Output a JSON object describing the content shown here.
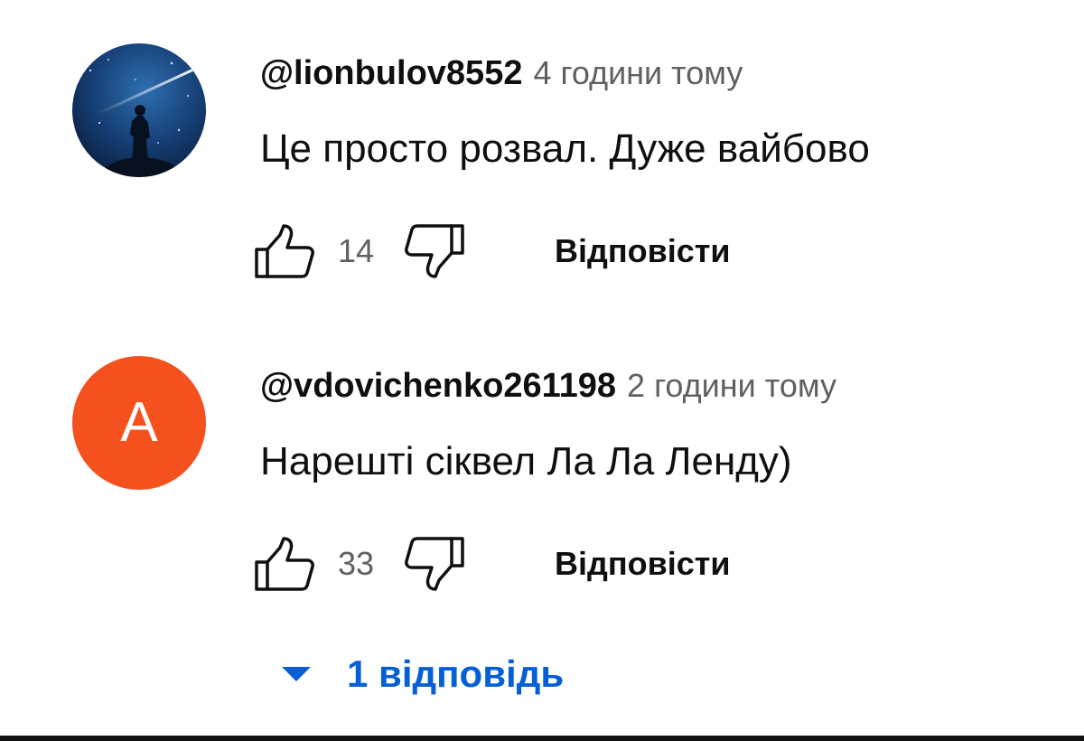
{
  "comments": [
    {
      "author": "@lionbulov8552",
      "time": "4 години тому",
      "text": "Це просто розвал. Дуже вайбово",
      "likes": "14",
      "reply_label": "Відповісти",
      "avatar": "night-sky-silhouette"
    },
    {
      "author": "@vdovichenko261198",
      "time": "2 години тому",
      "text": "Нарешті сіквел Ла Ла Ленду)",
      "likes": "33",
      "reply_label": "Відповісти",
      "avatar_letter": "A",
      "avatar_color": "#f4511e"
    }
  ],
  "replies_toggle": {
    "label": "1 відповідь",
    "icon": "caret-down-icon",
    "color": "#065fd4"
  },
  "icons": {
    "like": "thumb-up-icon",
    "dislike": "thumb-down-icon"
  }
}
